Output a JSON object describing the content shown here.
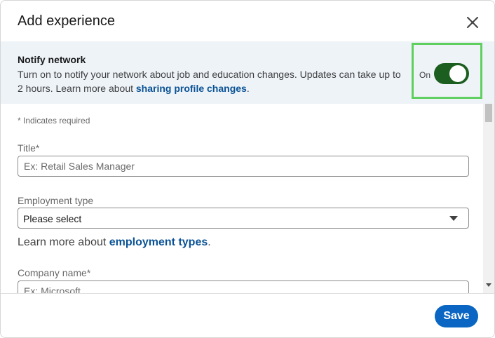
{
  "modal": {
    "title": "Add experience",
    "close_icon": "close-icon"
  },
  "notify": {
    "title": "Notify network",
    "description": "Turn on to notify your network about job and education changes. Updates can take up to 2 hours. Learn more about ",
    "link_text": "sharing profile changes",
    "link_suffix": ".",
    "toggle_label": "On",
    "toggle_state": "on",
    "toggle_color": "#1b5e20",
    "highlight_color": "#5fd05f"
  },
  "form": {
    "required_note": "* Indicates required",
    "title_label": "Title*",
    "title_placeholder": "Ex: Retail Sales Manager",
    "employment_label": "Employment type",
    "employment_value": "Please select",
    "learn_prefix": "Learn more about ",
    "learn_link": "employment types",
    "learn_suffix": ".",
    "company_label": "Company name*",
    "company_placeholder": "Ex: Microsoft"
  },
  "footer": {
    "save_label": "Save",
    "accent_color": "#0a66c2"
  }
}
